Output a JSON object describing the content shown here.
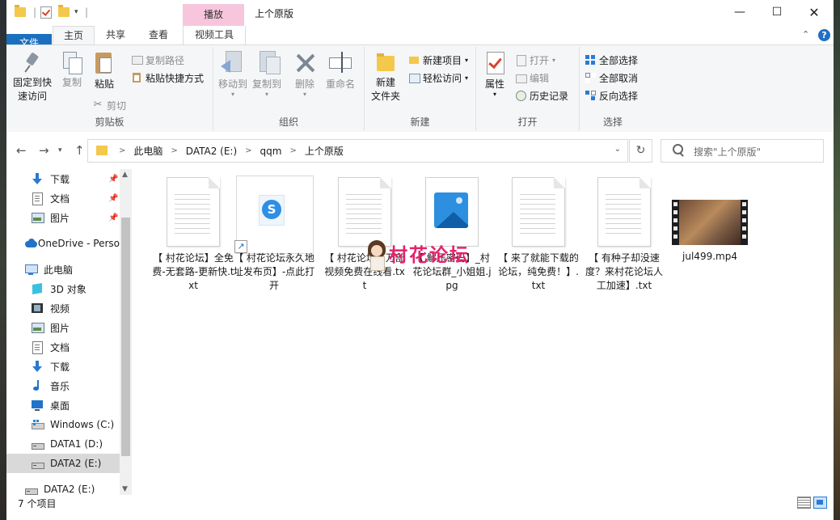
{
  "window": {
    "title": "上个原版",
    "context_tab": "播放"
  },
  "ribbon_tabs": {
    "file": "文件",
    "home": "主页",
    "share": "共享",
    "view": "查看",
    "video_tools": "视频工具"
  },
  "ribbon": {
    "clipboard": {
      "group": "剪贴板",
      "pin": "固定到快\n速访问",
      "copy": "复制",
      "paste": "粘贴",
      "copy_path": "复制路径",
      "paste_shortcut": "粘贴快捷方式",
      "cut": "剪切"
    },
    "organize": {
      "group": "组织",
      "move_to": "移动到",
      "copy_to": "复制到",
      "delete": "删除",
      "rename": "重命名"
    },
    "new": {
      "group": "新建",
      "new_folder": "新建\n文件夹",
      "new_item": "新建项目",
      "easy_access": "轻松访问"
    },
    "open": {
      "group": "打开",
      "properties": "属性",
      "open": "打开",
      "edit": "编辑",
      "history": "历史记录"
    },
    "select": {
      "group": "选择",
      "select_all": "全部选择",
      "select_none": "全部取消",
      "invert": "反向选择"
    }
  },
  "address": {
    "crumbs": [
      "此电脑",
      "DATA2 (E:)",
      "qqm",
      "上个原版"
    ],
    "search_placeholder": "搜索\"上个原版\""
  },
  "nav_pane": {
    "quick": [
      "下载",
      "文档",
      "图片"
    ],
    "onedrive": "OneDrive - Perso",
    "this_pc": "此电脑",
    "pc_items": [
      "3D 对象",
      "视频",
      "图片",
      "文档",
      "下载",
      "音乐",
      "桌面",
      "Windows (C:)",
      "DATA1 (D:)",
      "DATA2 (E:)"
    ],
    "bottom_drive": "DATA2 (E:)"
  },
  "files": [
    {
      "name": "【 村花论坛】全免费-无套路-更新快.txt",
      "type": "txt"
    },
    {
      "name": "【 村花论坛永久地址发布页】-点此打开",
      "type": "shortcut"
    },
    {
      "name": "【 村花论坛】万部视频免费在线看.txt",
      "type": "txt"
    },
    {
      "name": "【 解压密码】_村花论坛群_小姐姐.jpg",
      "type": "jpg"
    },
    {
      "name": "【 来了就能下载的论坛，纯免费！】.txt",
      "type": "txt"
    },
    {
      "name": "【 有种子却没速度？来村花论坛人工加速】.txt",
      "type": "txt"
    },
    {
      "name": "jul499.mp4",
      "type": "mp4"
    }
  ],
  "watermark": "村花论坛",
  "status": {
    "count": "7 个项目"
  }
}
